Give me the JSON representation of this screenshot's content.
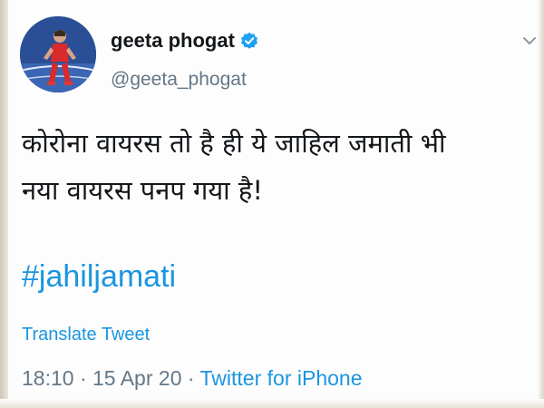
{
  "tweet": {
    "author": {
      "name": "geeta phogat",
      "handle": "@geeta_phogat",
      "verified": true,
      "verified_icon": "verified-badge-icon",
      "verified_color": "#1da1f2"
    },
    "menu_icon": "chevron-down-icon",
    "text_lines": [
      "कोरोना वायरस तो है ही ये जाहिल जमाती भी",
      "नया वायरस पनप गया है!"
    ],
    "hashtag": "#jahiljamati",
    "translate_label": "Translate Tweet",
    "time": "18:10",
    "date": "15 Apr 20",
    "separator": "·",
    "source": "Twitter for iPhone"
  },
  "colors": {
    "link": "#1b95e0",
    "text": "#14171a",
    "muted": "#657786"
  }
}
